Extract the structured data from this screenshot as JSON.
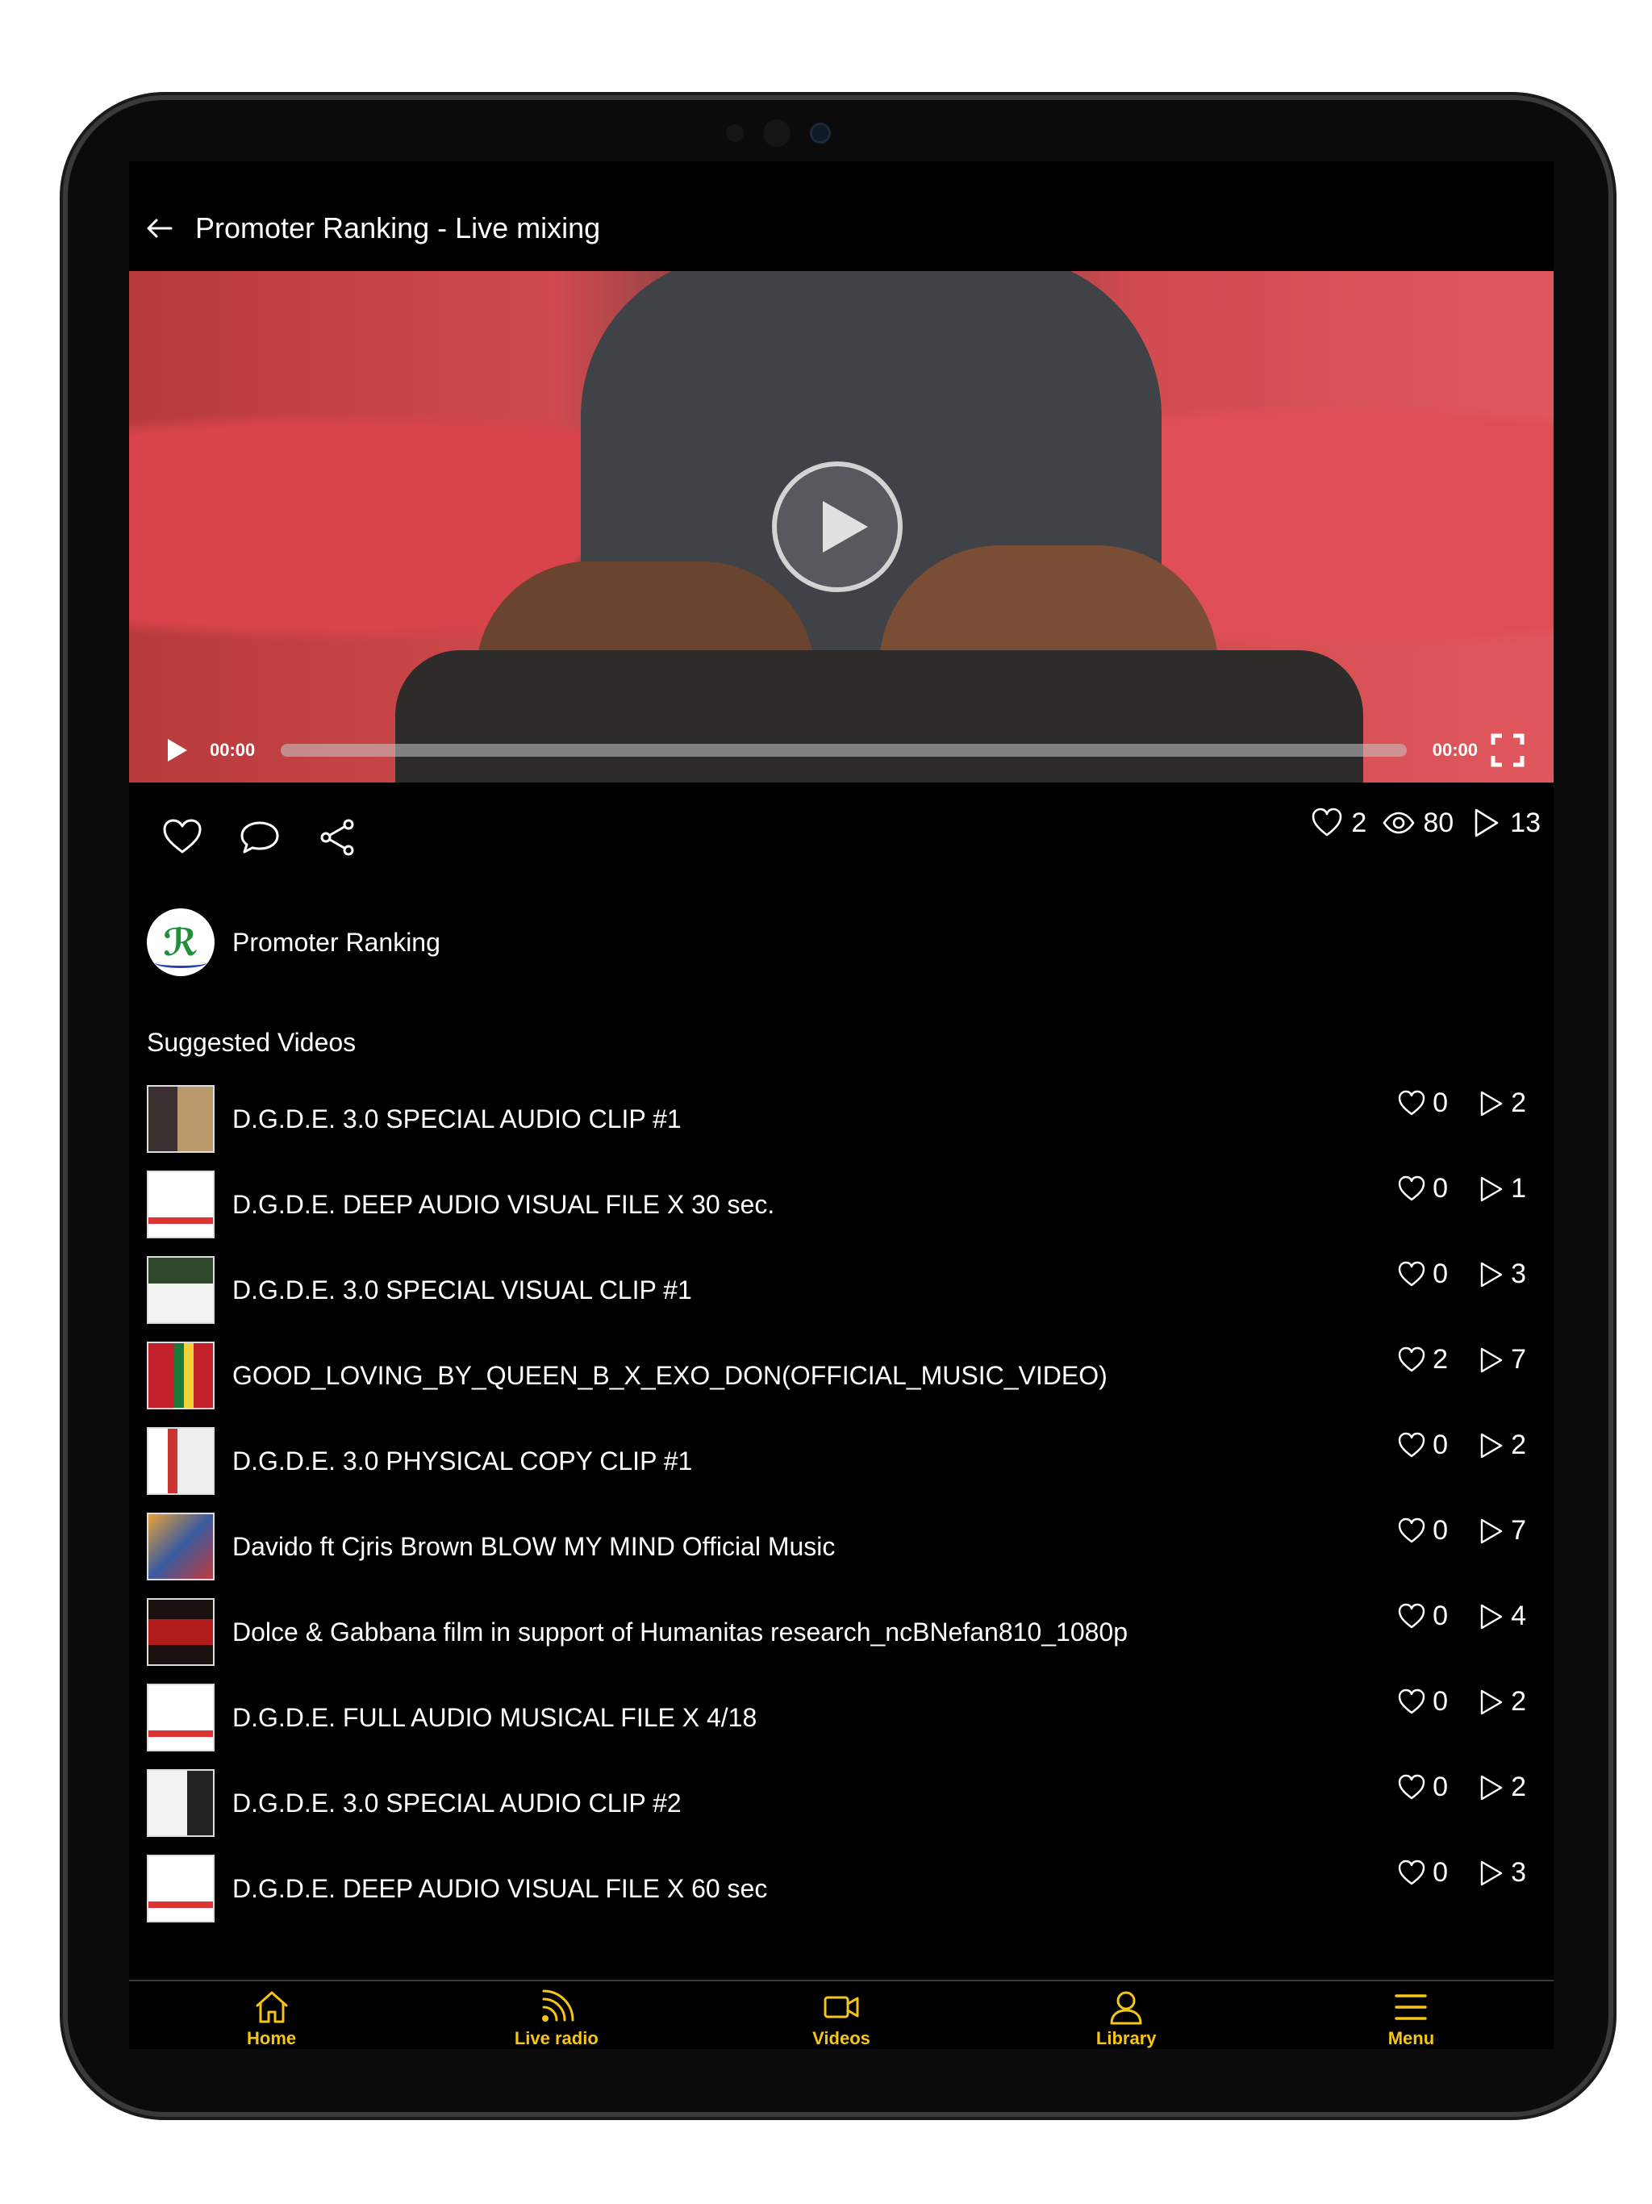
{
  "header": {
    "title": "Promoter Ranking - Live mixing"
  },
  "player": {
    "current_time": "00:00",
    "duration": "00:00"
  },
  "stats": {
    "likes": "2",
    "views": "80",
    "plays": "13"
  },
  "channel": {
    "name": "Promoter Ranking"
  },
  "suggested": {
    "title": "Suggested Videos",
    "items": [
      {
        "title": "D.G.D.E. 3.0 SPECIAL AUDIO CLIP #1",
        "likes": "0",
        "plays": "2"
      },
      {
        "title": "D.G.D.E. DEEP AUDIO VISUAL  FILE X 30 sec.",
        "likes": "0",
        "plays": "1"
      },
      {
        "title": "D.G.D.E. 3.0 SPECIAL VISUAL CLIP #1",
        "likes": "0",
        "plays": "3"
      },
      {
        "title": "GOOD_LOVING_BY_QUEEN_B_X_EXO_DON(OFFICIAL_MUSIC_VIDEO)",
        "likes": "2",
        "plays": "7"
      },
      {
        "title": "D.G.D.E. 3.0 PHYSICAL COPY CLIP #1",
        "likes": "0",
        "plays": "2"
      },
      {
        "title": "Davido ft Cjris Brown BLOW MY MIND Official Music",
        "likes": "0",
        "plays": "7"
      },
      {
        "title": "Dolce & Gabbana film in support of Humanitas research_ncBNefan810_1080p",
        "likes": "0",
        "plays": "4"
      },
      {
        "title": "D.G.D.E. FULL AUDIO MUSICAL FILE X 4/18",
        "likes": "0",
        "plays": "2"
      },
      {
        "title": "D.G.D.E. 3.0 SPECIAL AUDIO CLIP #2",
        "likes": "0",
        "plays": "2"
      },
      {
        "title": "D.G.D.E. DEEP AUDIO VISUAL  FILE X 60 sec",
        "likes": "0",
        "plays": "3"
      }
    ]
  },
  "tabbar": {
    "accent_color": "#f5c518",
    "items": [
      {
        "label": "Home",
        "icon": "home-icon"
      },
      {
        "label": "Live radio",
        "icon": "radio-icon"
      },
      {
        "label": "Videos",
        "icon": "video-camera-icon"
      },
      {
        "label": "Library",
        "icon": "user-icon"
      },
      {
        "label": "Menu",
        "icon": "menu-icon"
      }
    ]
  }
}
